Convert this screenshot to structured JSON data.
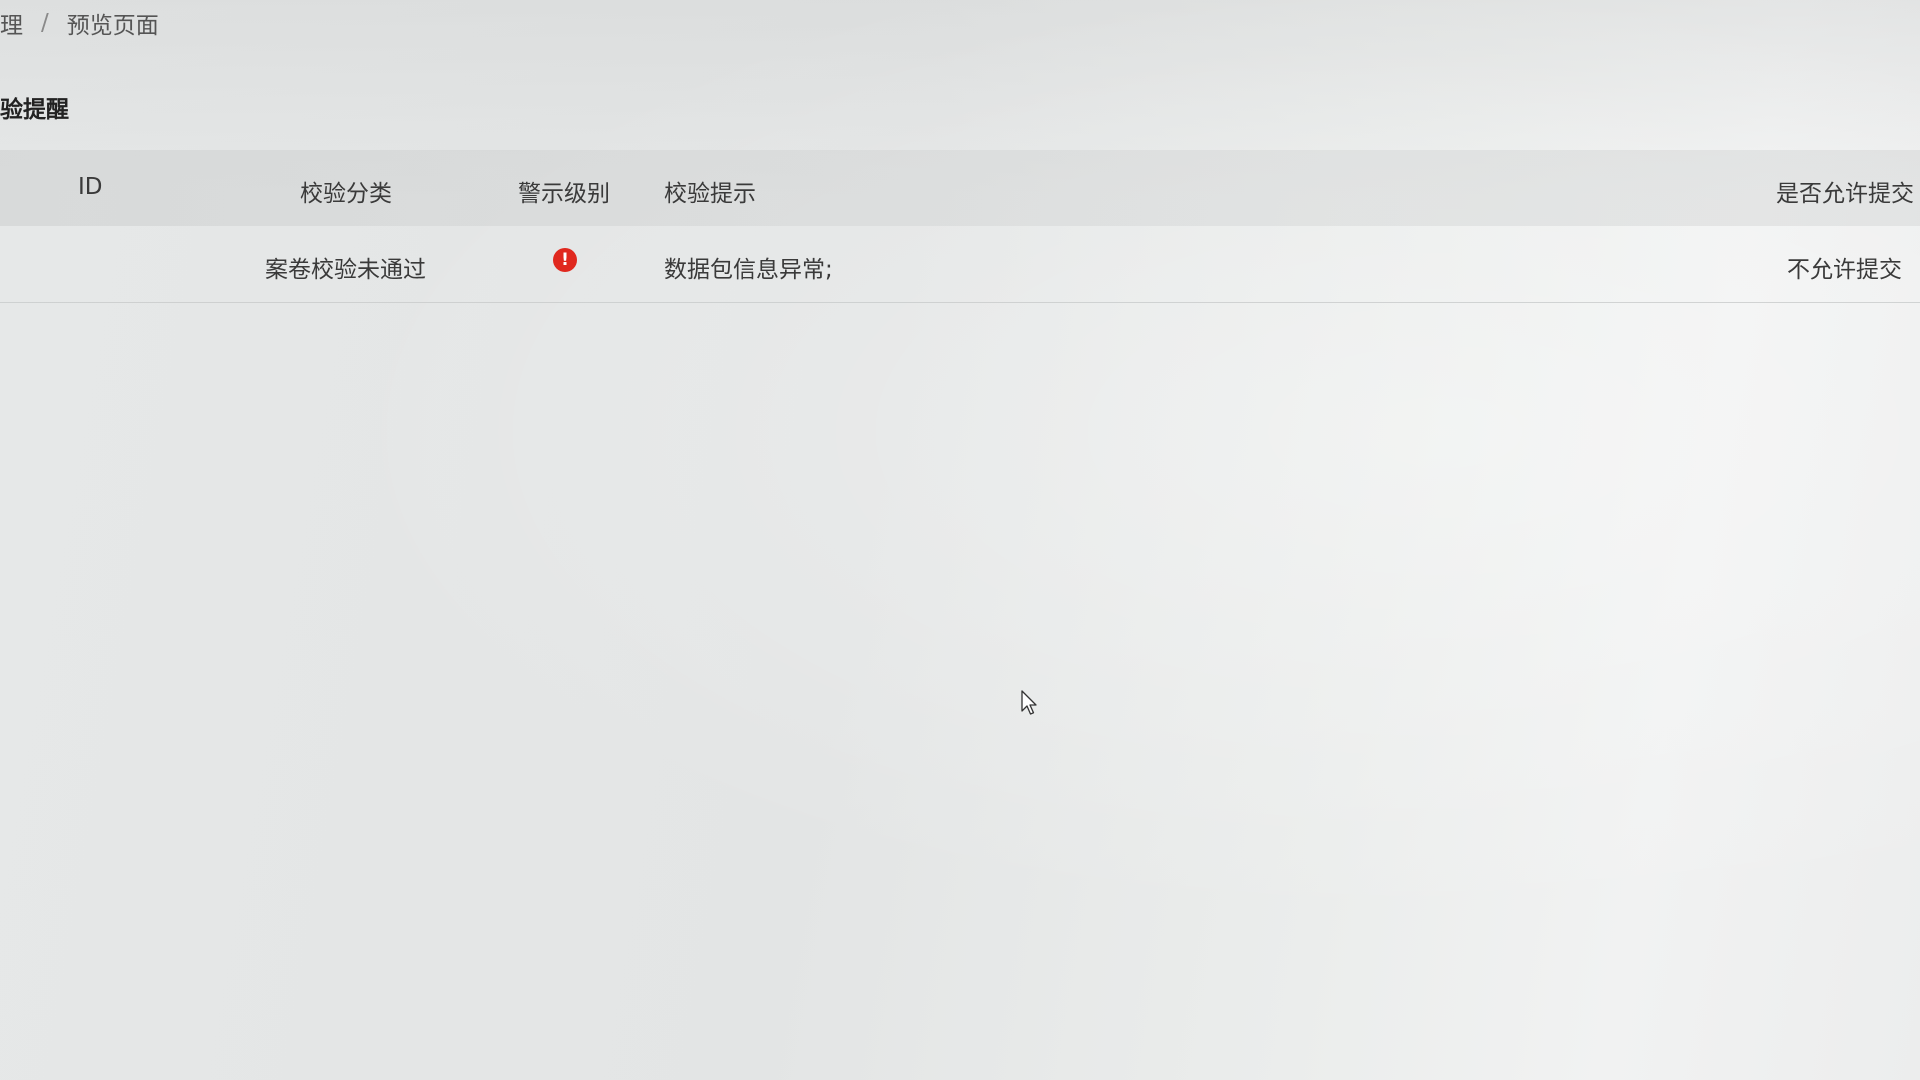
{
  "breadcrumb": {
    "parent": "理",
    "separator": "/",
    "current": "预览页面"
  },
  "section": {
    "title": "验提醒"
  },
  "table": {
    "headers": {
      "id": "ID",
      "category": "校验分类",
      "level": "警示级别",
      "tip": "校验提示",
      "allow": "是否允许提交"
    },
    "rows": [
      {
        "id": "",
        "category": "案卷校验未通过",
        "level_icon": "exclamation-circle-icon",
        "level_color": "#e0281e",
        "tip": "数据包信息异常;",
        "allow": "不允许提交"
      }
    ]
  },
  "icons": {
    "alert_glyph": "!"
  }
}
